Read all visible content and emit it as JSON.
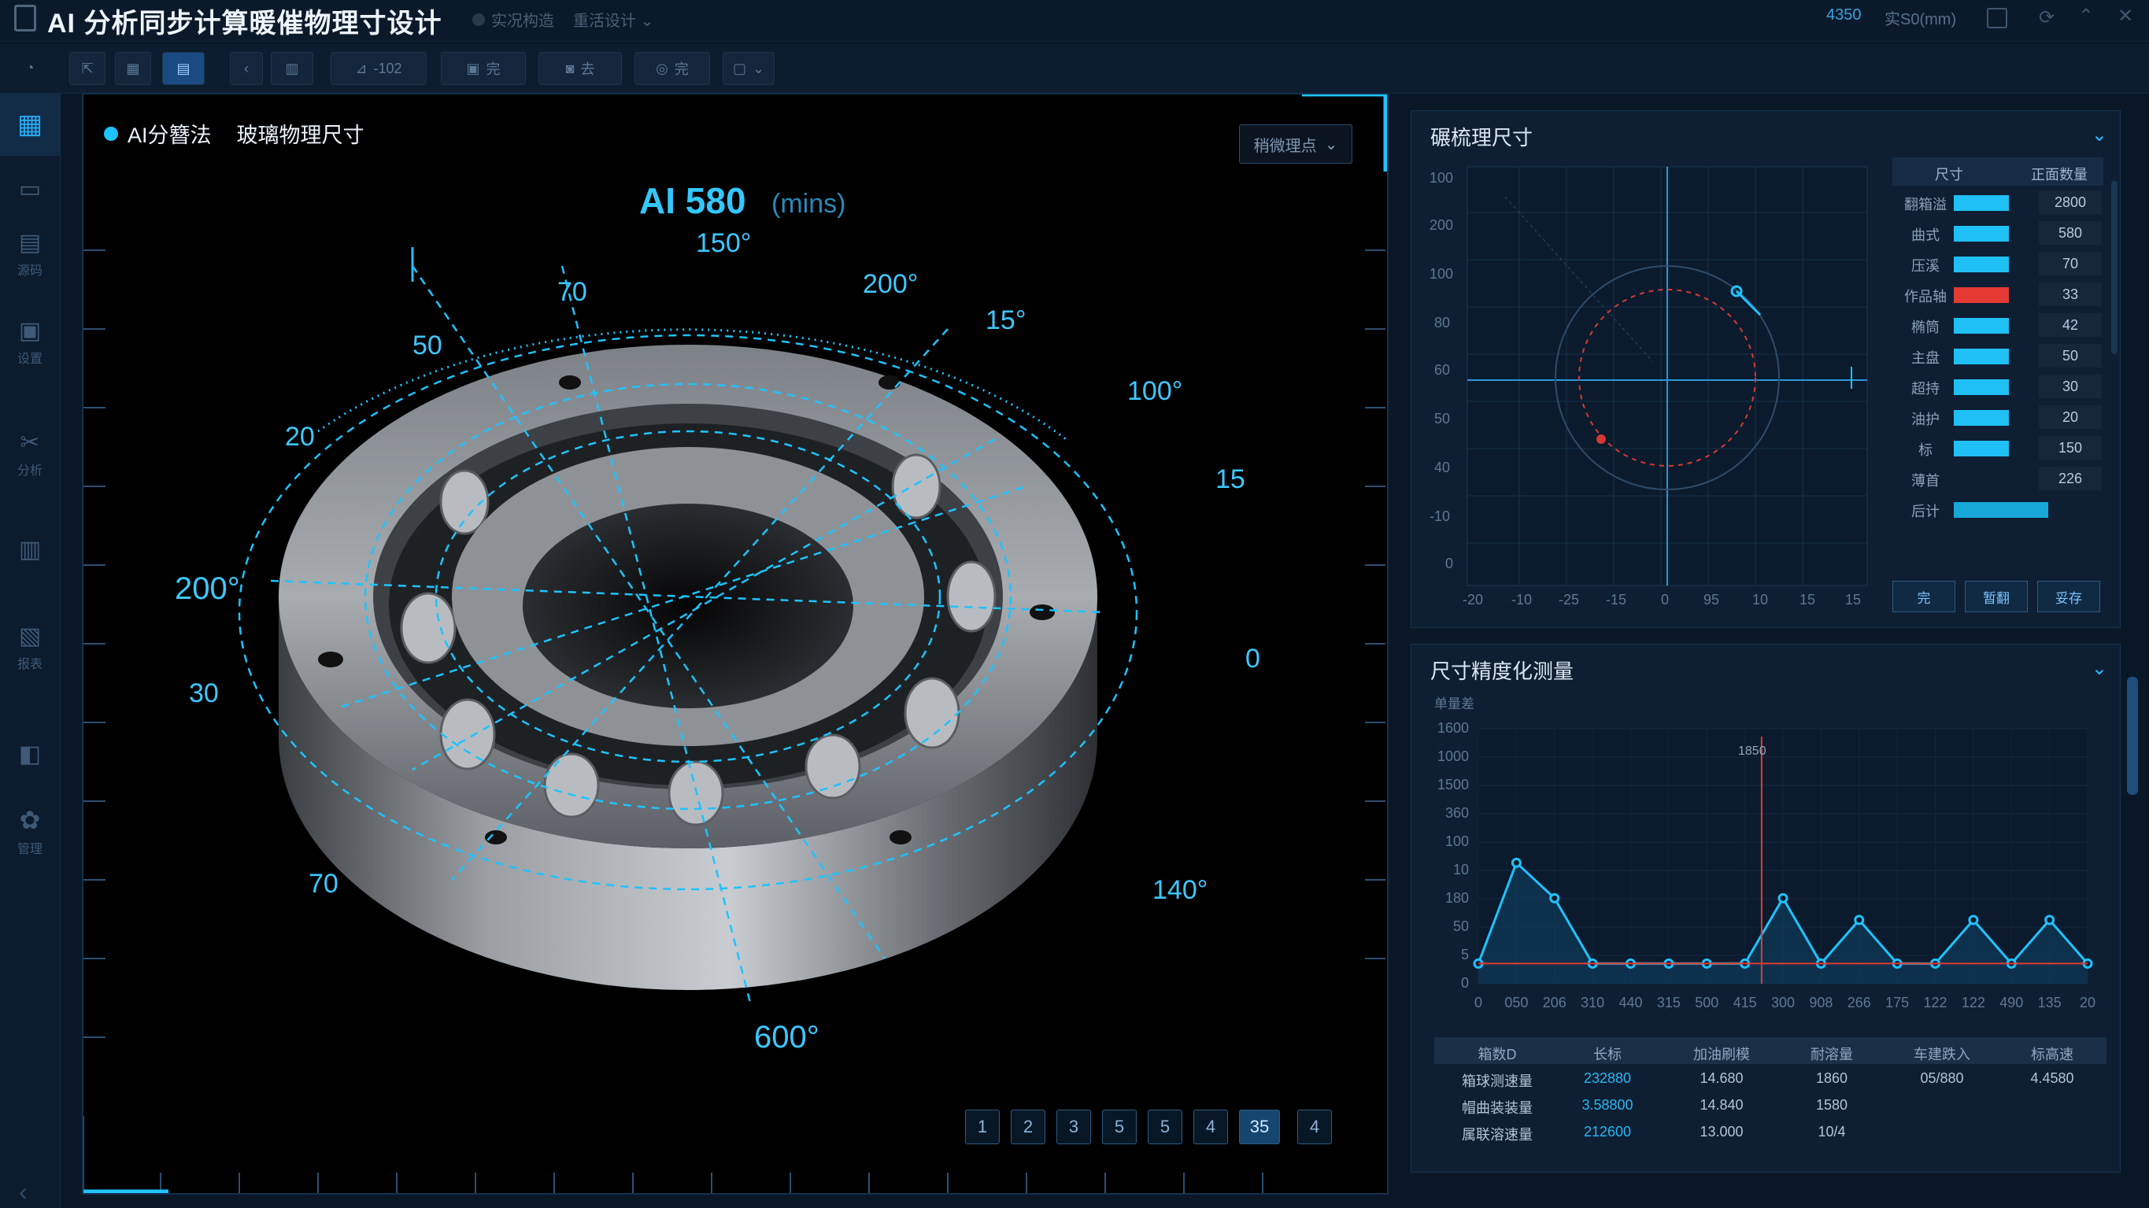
{
  "app": {
    "title": "AI 分析同步计算暖催物理寸设计",
    "title_menus": [
      "实况构造",
      "重活设计"
    ],
    "right_info": [
      "4350",
      "实S0(mm)"
    ]
  },
  "toolbar": {
    "buttons": [
      {
        "icon": "gauge-icon",
        "label": ""
      },
      {
        "icon": "export-icon",
        "label": ""
      },
      {
        "icon": "grid-icon",
        "label": ""
      },
      {
        "icon": "layer-icon",
        "label": "",
        "active": true
      },
      {
        "icon": "back-icon",
        "label": "‹"
      },
      {
        "icon": "panel-icon",
        "label": ""
      },
      {
        "icon": "measure-icon",
        "label": "-102"
      },
      {
        "icon": "table-icon",
        "label": "完"
      },
      {
        "icon": "camera-icon",
        "label": "去"
      },
      {
        "icon": "target-icon",
        "label": "完"
      },
      {
        "icon": "dropdown-icon",
        "label": "⌄"
      }
    ]
  },
  "sidebar": {
    "items": [
      {
        "icon": "dashboard-icon",
        "label": "",
        "active": true
      },
      {
        "icon": "model-icon",
        "label": ""
      },
      {
        "icon": "document-icon",
        "label": "源码"
      },
      {
        "icon": "database-icon",
        "label": "设置"
      },
      {
        "icon": "tools-icon",
        "label": "分析"
      },
      {
        "icon": "report-icon",
        "label": ""
      },
      {
        "icon": "chart-icon",
        "label": "报表"
      },
      {
        "icon": "layout-icon",
        "label": ""
      },
      {
        "icon": "settings-icon",
        "label": "管理"
      }
    ]
  },
  "viewport": {
    "legend_label": "AI分簪法",
    "legend_title": "玻璃物理尺寸",
    "select_value": "稍微理点",
    "heading": "AI 580",
    "heading_unit": "(mins)",
    "angle_labels": {
      "top": "150°",
      "a70": "70",
      "a200": "200°",
      "a15": "15°",
      "a50": "50",
      "a100": "100°",
      "a20": "20",
      "r15": "15",
      "l200": "200°",
      "r0": "0",
      "l30": "30",
      "l70": "70",
      "r140": "140°",
      "b600": "600°"
    },
    "pages": [
      "1",
      "2",
      "3",
      "5",
      "5",
      "4",
      "35",
      "4"
    ],
    "active_page": 6
  },
  "panel_top": {
    "title": "碾梳理尺寸",
    "table_header": [
      "尺寸",
      "正面数量"
    ],
    "rows": [
      {
        "label": "翻箱溢",
        "value": "2800",
        "ratio": 0.35,
        "color": "#1fc0f5"
      },
      {
        "label": "曲式",
        "value": "580",
        "ratio": 0.35,
        "color": "#1fc0f5"
      },
      {
        "label": "压溪",
        "value": "70",
        "ratio": 0.35,
        "color": "#1fc0f5"
      },
      {
        "label": "作品轴",
        "value": "33",
        "ratio": 0.35,
        "color": "#e53a33"
      },
      {
        "label": "椭筒",
        "value": "42",
        "ratio": 0.35,
        "color": "#1fc0f5"
      },
      {
        "label": "主盘",
        "value": "50",
        "ratio": 0.35,
        "color": "#1fc0f5"
      },
      {
        "label": "超持",
        "value": "30",
        "ratio": 0.35,
        "color": "#1fc0f5"
      },
      {
        "label": "油护",
        "value": "20",
        "ratio": 0.35,
        "color": "#1fc0f5"
      },
      {
        "label": "标",
        "value": "150",
        "ratio": 0.35,
        "color": "#1fc0f5"
      },
      {
        "label": "薄首",
        "value": "226",
        "ratio": 0,
        "color": "#1fc0f5"
      },
      {
        "label": "后计",
        "value": "",
        "ratio": 0.6,
        "color": "#18a8d8"
      }
    ],
    "buttons": [
      "完",
      "暂翻",
      "妥存"
    ],
    "scatter_y_ticks": [
      "100",
      "200",
      "100",
      "80",
      "60",
      "50",
      "40",
      "-10",
      "0"
    ],
    "scatter_x_ticks": [
      "-20",
      "-10",
      "-25",
      "-15",
      "0",
      "95",
      "10",
      "15",
      "15"
    ]
  },
  "panel_bottom": {
    "title": "尺寸精度化测量",
    "y_unit": "单量差",
    "marker_label": "1850",
    "y_ticks": [
      "1600",
      "1000",
      "1500",
      "360",
      "100",
      "10",
      "180",
      "50",
      "5",
      "0"
    ],
    "x_ticks": [
      "0",
      "050",
      "206",
      "310",
      "440",
      "315",
      "500",
      "415",
      "300",
      "908",
      "266",
      "175",
      "122",
      "122",
      "490",
      "135",
      "20"
    ],
    "table": {
      "headers": [
        "箱数D",
        "长标",
        "加油刷模",
        "耐溶量",
        "车建跌入",
        "标高速"
      ],
      "rows": [
        [
          "箱球测速量",
          "232880",
          "14.680",
          "1860",
          "05/880",
          "4.4580"
        ],
        [
          "帽曲装装量",
          "3.58800",
          "14.840",
          "1580",
          "",
          ""
        ],
        [
          "属联溶速量",
          "212600",
          "13.000",
          "10/4",
          "",
          ""
        ]
      ]
    }
  },
  "chart_data": {
    "type": "line",
    "title": "尺寸精度化测量",
    "ylabel": "单量差",
    "x": [
      "0",
      "050",
      "206",
      "310",
      "440",
      "315",
      "500",
      "415",
      "300",
      "908",
      "266",
      "175",
      "122",
      "122",
      "490",
      "135",
      "20"
    ],
    "series": [
      {
        "values": [
          10,
          360,
          180,
          10,
          10,
          10,
          10,
          10,
          180,
          10,
          100,
          10,
          10,
          100,
          10,
          100,
          10
        ]
      }
    ],
    "ylim": [
      0,
      1600
    ],
    "grid": true
  },
  "colors": {
    "accent": "#1ec3ff",
    "alert": "#e53a33",
    "panel_bg": "#0e1f33",
    "background": "#0a1726"
  }
}
